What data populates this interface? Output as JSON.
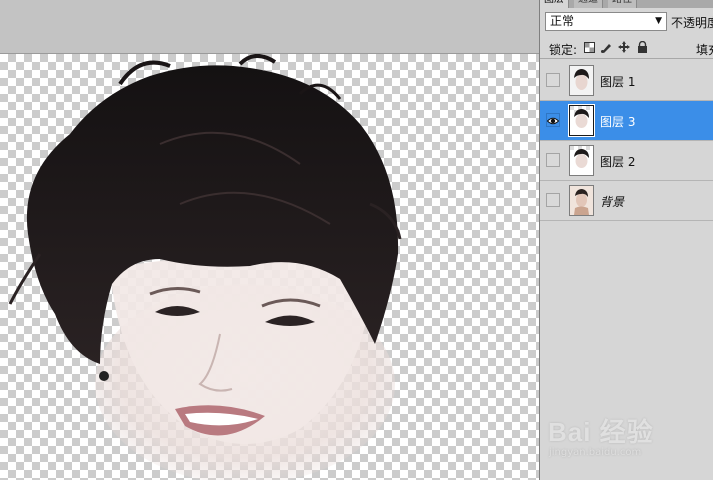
{
  "panel": {
    "tabs": [
      "图层",
      "通道",
      "路径"
    ],
    "blend_mode": "正常",
    "opacity_label": "不透明度",
    "lock_label": "锁定:",
    "fill_label": "填充",
    "lock_icons": [
      "lock-transparent-pixels-icon",
      "lock-image-pixels-icon",
      "lock-position-icon",
      "lock-all-icon"
    ]
  },
  "layers": [
    {
      "name": "图层 1",
      "visible": false,
      "selected": false,
      "italic": false
    },
    {
      "name": "图层 3",
      "visible": true,
      "selected": true,
      "italic": false
    },
    {
      "name": "图层 2",
      "visible": false,
      "selected": false,
      "italic": false
    },
    {
      "name": "背景",
      "visible": false,
      "selected": false,
      "italic": true
    }
  ],
  "watermark": {
    "brand": "Bai 经验",
    "url": "jingyan.baidu.com"
  },
  "colors": {
    "selected_layer": "#3b8ee8",
    "panel_bg": "#d6d6d6",
    "canvas_bg": "#b8b8b8",
    "hair": "#1b1718",
    "skin": "#f1e7e4"
  }
}
